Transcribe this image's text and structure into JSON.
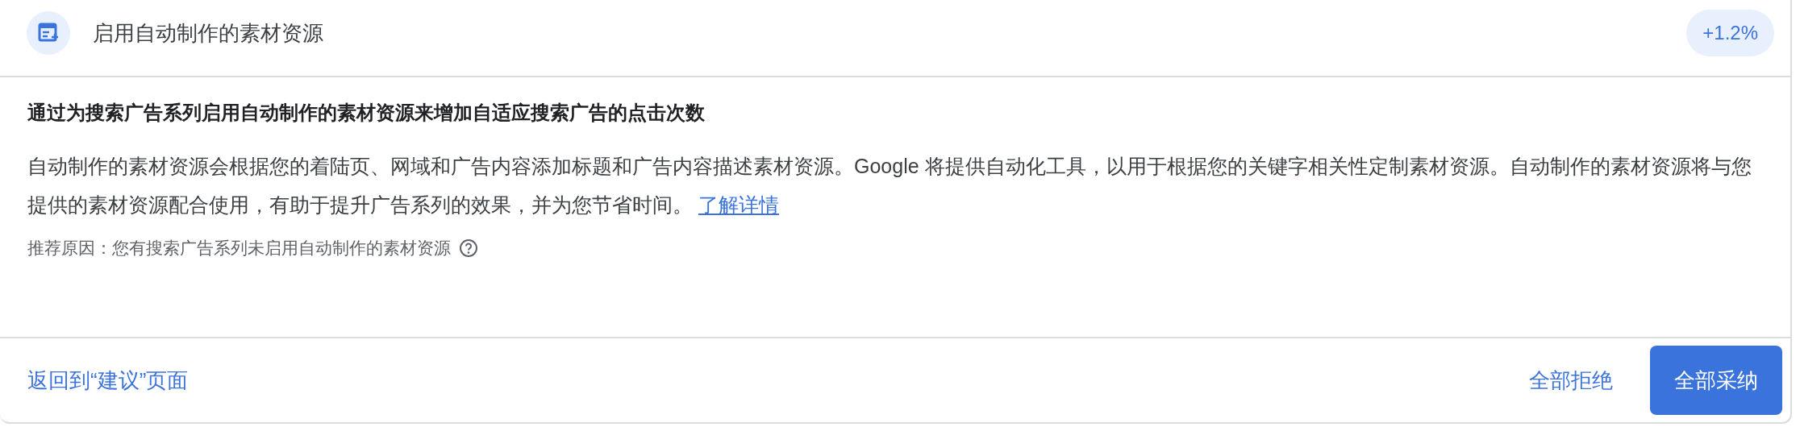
{
  "header": {
    "title": "启用自动制作的素材资源",
    "badge": "+1.2%"
  },
  "body": {
    "heading": "通过为搜索广告系列启用自动制作的素材资源来增加自适应搜索广告的点击次数",
    "description": "自动制作的素材资源会根据您的着陆页、网域和广告内容添加标题和广告内容描述素材资源。Google 将提供自动化工具，以用于根据您的关键字相关性定制素材资源。自动制作的素材资源将与您提供的素材资源配合使用，有助于提升广告系列的效果，并为您节省时间。",
    "link": "了解详情",
    "reason": "推荐原因：您有搜索广告系列未启用自动制作的素材资源"
  },
  "footer": {
    "back_link": "返回到“建议”页面",
    "buttons": [
      {
        "label": "全部拒绝",
        "kind": "text"
      },
      {
        "label": "全部采纳",
        "kind": "primary"
      }
    ]
  }
}
